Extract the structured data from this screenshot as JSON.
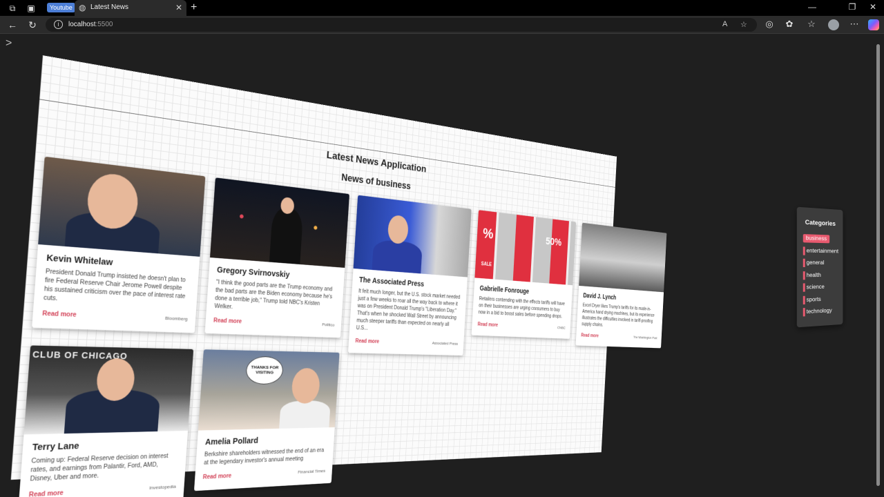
{
  "browser": {
    "tab_badge": "Youtube",
    "tab_title": "Latest News",
    "url_host": "localhost",
    "url_port": ":5500"
  },
  "page": {
    "app_title": "Latest News Application",
    "section_title": "News of business",
    "read_more": "Read more"
  },
  "articles": [
    {
      "author": "Kevin Whitelaw",
      "description": "President Donald Trump insisted he doesn't plan to fire Federal Reserve Chair Jerome Powell despite his sustained criticism over the pace of interest rate cuts.",
      "source": "Bloomberg"
    },
    {
      "author": "Gregory Svirnovskiy",
      "description": "\"I think the good parts are the Trump economy and the bad parts are the Biden economy because he's done a terrible job,\" Trump told NBC's Kristen Welker.",
      "source": "Politico"
    },
    {
      "author": "The Associated Press",
      "description": "It felt much longer, but the U.S. stock market needed just a few weeks to roar all the way back to where it was on President Donald Trump's \"Liberation Day.\" That's when he shocked Wall Street by announcing much steeper tariffs than expected on nearly all U.S...",
      "source": "Associated Press"
    },
    {
      "author": "Gabrielle Fonrouge",
      "description": "Retailers contending with the effects tariffs will have on their businesses are urging consumers to buy now in a bid to boost sales before spending drops.",
      "source": "CNBC"
    },
    {
      "author": "David J. Lynch",
      "description": "Excel Dryer likes Trump's tariffs for its made-in-America hand drying machines, but its experience illustrates the difficulties involved in tariff-proofing supply chains.",
      "source": "The Washington Post"
    },
    {
      "author": "Terry Lane",
      "description": "Coming up: Federal Reserve decision on interest rates, and earnings from Palantir, Ford, AMD, Disney, Uber and more.",
      "source": "Investopedia"
    },
    {
      "author": "Amelia Pollard",
      "description": "Berkshire shareholders witnessed the end of an era at the legendary investor's annual meeting",
      "source": "Financial Times"
    }
  ],
  "image_text": {
    "sale_left": "%",
    "sale_right": "50%",
    "sign_sale": "SALE",
    "speech_bubble": "THANKS FOR VISITING",
    "backdrop_top": "CLUB OF CHICAGO"
  },
  "categories": {
    "title": "Categories",
    "items": [
      "business",
      "entertainment",
      "general",
      "health",
      "science",
      "sports",
      "technology"
    ],
    "active": "business"
  }
}
